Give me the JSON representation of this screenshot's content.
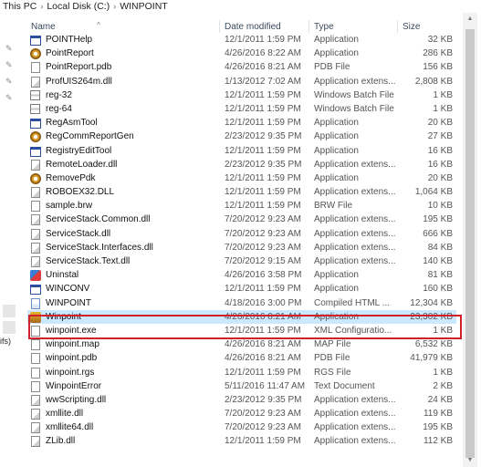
{
  "breadcrumb": {
    "items": [
      "This PC",
      "Local Disk (C:)",
      "WINPOINT"
    ]
  },
  "columns": {
    "name": "Name",
    "date": "Date modified",
    "type": "Type",
    "size": "Size"
  },
  "left_pane": {
    "label": "ifs)"
  },
  "files": [
    {
      "name": "POINTHelp",
      "date": "12/1/2011 1:59 PM",
      "type": "Application",
      "size": "32 KB",
      "icon": "app-icon"
    },
    {
      "name": "PointReport",
      "date": "4/26/2016 8:22 AM",
      "type": "Application",
      "size": "286 KB",
      "icon": "gear-app-icon"
    },
    {
      "name": "PointReport.pdb",
      "date": "4/26/2016 8:21 AM",
      "type": "PDB File",
      "size": "156 KB",
      "icon": "file-icon"
    },
    {
      "name": "ProfUIS264m.dll",
      "date": "1/13/2012 7:02 AM",
      "type": "Application extens...",
      "size": "2,808 KB",
      "icon": "dll-icon"
    },
    {
      "name": "reg-32",
      "date": "12/1/2011 1:59 PM",
      "type": "Windows Batch File",
      "size": "1 KB",
      "icon": "batch-file-icon"
    },
    {
      "name": "reg-64",
      "date": "12/1/2011 1:59 PM",
      "type": "Windows Batch File",
      "size": "1 KB",
      "icon": "batch-file-icon"
    },
    {
      "name": "RegAsmTool",
      "date": "12/1/2011 1:59 PM",
      "type": "Application",
      "size": "20 KB",
      "icon": "app-icon"
    },
    {
      "name": "RegCommReportGen",
      "date": "2/23/2012 9:35 PM",
      "type": "Application",
      "size": "27 KB",
      "icon": "gear-app-icon"
    },
    {
      "name": "RegistryEditTool",
      "date": "12/1/2011 1:59 PM",
      "type": "Application",
      "size": "16 KB",
      "icon": "app-icon"
    },
    {
      "name": "RemoteLoader.dll",
      "date": "2/23/2012 9:35 PM",
      "type": "Application extens...",
      "size": "16 KB",
      "icon": "dll-icon"
    },
    {
      "name": "RemovePdk",
      "date": "12/1/2011 1:59 PM",
      "type": "Application",
      "size": "20 KB",
      "icon": "gear-app-icon"
    },
    {
      "name": "ROBOEX32.DLL",
      "date": "12/1/2011 1:59 PM",
      "type": "Application extens...",
      "size": "1,064 KB",
      "icon": "dll-icon"
    },
    {
      "name": "sample.brw",
      "date": "12/1/2011 1:59 PM",
      "type": "BRW File",
      "size": "10 KB",
      "icon": "file-icon"
    },
    {
      "name": "ServiceStack.Common.dll",
      "date": "7/20/2012 9:23 AM",
      "type": "Application extens...",
      "size": "195 KB",
      "icon": "dll-icon"
    },
    {
      "name": "ServiceStack.dll",
      "date": "7/20/2012 9:23 AM",
      "type": "Application extens...",
      "size": "666 KB",
      "icon": "dll-icon"
    },
    {
      "name": "ServiceStack.Interfaces.dll",
      "date": "7/20/2012 9:23 AM",
      "type": "Application extens...",
      "size": "84 KB",
      "icon": "dll-icon"
    },
    {
      "name": "ServiceStack.Text.dll",
      "date": "7/20/2012 9:15 AM",
      "type": "Application extens...",
      "size": "140 KB",
      "icon": "dll-icon"
    },
    {
      "name": "Uninstal",
      "date": "4/26/2016 3:58 PM",
      "type": "Application",
      "size": "81 KB",
      "icon": "uninstall-icon"
    },
    {
      "name": "WINCONV",
      "date": "12/1/2011 1:59 PM",
      "type": "Application",
      "size": "160 KB",
      "icon": "app-icon"
    },
    {
      "name": "WINPOINT",
      "date": "4/18/2016 3:00 PM",
      "type": "Compiled HTML ...",
      "size": "12,304 KB",
      "icon": "help-file-icon"
    },
    {
      "name": "Winpoint",
      "date": "4/26/2016 8:21 AM",
      "type": "Application",
      "size": "23,302 KB",
      "icon": "winpoint-app-icon",
      "selected": true
    },
    {
      "name": "winpoint.exe",
      "date": "12/1/2011 1:59 PM",
      "type": "XML Configuratio...",
      "size": "1 KB",
      "icon": "file-icon"
    },
    {
      "name": "winpoint.map",
      "date": "4/26/2016 8:21 AM",
      "type": "MAP File",
      "size": "6,532 KB",
      "icon": "file-icon"
    },
    {
      "name": "winpoint.pdb",
      "date": "4/26/2016 8:21 AM",
      "type": "PDB File",
      "size": "41,979 KB",
      "icon": "file-icon"
    },
    {
      "name": "winpoint.rgs",
      "date": "12/1/2011 1:59 PM",
      "type": "RGS File",
      "size": "1 KB",
      "icon": "file-icon"
    },
    {
      "name": "WinpointError",
      "date": "5/11/2016 11:47 AM",
      "type": "Text Document",
      "size": "2 KB",
      "icon": "text-file-icon"
    },
    {
      "name": "wwScripting.dll",
      "date": "2/23/2012 9:35 PM",
      "type": "Application extens...",
      "size": "24 KB",
      "icon": "dll-icon"
    },
    {
      "name": "xmllite.dll",
      "date": "7/20/2012 9:23 AM",
      "type": "Application extens...",
      "size": "119 KB",
      "icon": "dll-icon"
    },
    {
      "name": "xmllite64.dll",
      "date": "7/20/2012 9:23 AM",
      "type": "Application extens...",
      "size": "195 KB",
      "icon": "dll-icon"
    },
    {
      "name": "ZLib.dll",
      "date": "12/1/2011 1:59 PM",
      "type": "Application extens...",
      "size": "112 KB",
      "icon": "dll-icon"
    }
  ]
}
